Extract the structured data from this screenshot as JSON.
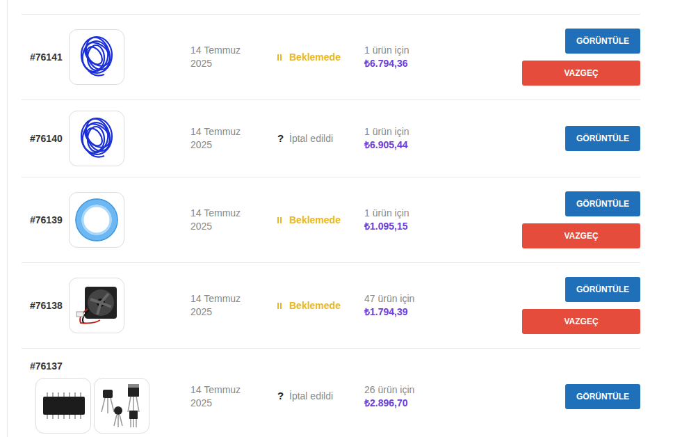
{
  "orders": [
    {
      "number": "#76141",
      "thumbnails": [
        {
          "kind": "coil"
        }
      ],
      "date": [
        "14 Temmuz",
        "2025"
      ],
      "status": {
        "kind": "pending",
        "label": "Beklemede"
      },
      "count": "1 ürün için",
      "total": "₺6.794,36",
      "actions": [
        "GÖRÜNTÜLE",
        "VAZGEÇ"
      ]
    },
    {
      "number": "#76140",
      "thumbnails": [
        {
          "kind": "coil"
        }
      ],
      "date": [
        "14 Temmuz",
        "2025"
      ],
      "status": {
        "kind": "cancelled",
        "icon": "?",
        "label": "İptal edildi"
      },
      "count": "1 ürün için",
      "total": "₺6.905,44",
      "actions": [
        "GÖRÜNTÜLE"
      ]
    },
    {
      "number": "#76139",
      "thumbnails": [
        {
          "kind": "tube"
        }
      ],
      "date": [
        "14 Temmuz",
        "2025"
      ],
      "status": {
        "kind": "pending",
        "label": "Beklemede"
      },
      "count": "1 ürün için",
      "total": "₺1.095,15",
      "actions": [
        "GÖRÜNTÜLE",
        "VAZGEÇ"
      ]
    },
    {
      "number": "#76138",
      "thumbnails": [
        {
          "kind": "fan"
        }
      ],
      "date": [
        "14 Temmuz",
        "2025"
      ],
      "status": {
        "kind": "pending",
        "label": "Beklemede"
      },
      "count": "47 ürün için",
      "total": "₺1.794,39",
      "actions": [
        "GÖRÜNTÜLE",
        "VAZGEÇ"
      ]
    },
    {
      "number": "#76137",
      "thumbnails": [
        {
          "kind": "ic"
        },
        {
          "kind": "transistor"
        }
      ],
      "date": [
        "14 Temmuz",
        "2025"
      ],
      "status": {
        "kind": "cancelled",
        "icon": "?",
        "label": "İptal edildi"
      },
      "count": "26 ürün için",
      "total": "₺2.896,70",
      "actions": [
        "GÖRÜNTÜLE"
      ]
    }
  ]
}
